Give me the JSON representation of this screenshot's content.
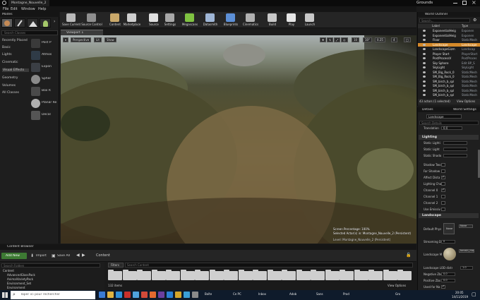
{
  "window": {
    "title": "Montagne_Nouvelle_2",
    "project": "Grounds",
    "controls": [
      "minimize-icon",
      "maximize-icon",
      "close-icon"
    ]
  },
  "menu": [
    "File",
    "Edit",
    "Window",
    "Help"
  ],
  "modes": {
    "tab_title": "Modes",
    "search_placeholder": "Search Classes",
    "categories": [
      "Recently Placed",
      "Basic",
      "Lights",
      "Cinematic",
      "Visual Effects",
      "Geometry",
      "Volumes",
      "All Classes"
    ],
    "selected_category": "Visual Effects",
    "actors": [
      "Post P",
      "Atmos",
      "Expon",
      "Spher",
      "Box R",
      "Planar Re",
      "Decal"
    ]
  },
  "toolbar": {
    "buttons": [
      {
        "label": "Save Current",
        "icon": "save-icon",
        "color": "#b9b9b9"
      },
      {
        "label": "Source Control",
        "icon": "source-control-icon",
        "color": "#8f8f8f"
      },
      {
        "label": "Content",
        "icon": "content-icon",
        "color": "#c9a86a"
      },
      {
        "label": "Marketplace",
        "icon": "marketplace-icon",
        "color": "#cfcfcf"
      },
      {
        "label": "Source",
        "icon": "source-icon",
        "color": "#e0e0e0"
      },
      {
        "label": "Settings",
        "icon": "gear-icon",
        "color": "#a8a8a8"
      },
      {
        "label": "Megascans",
        "icon": "megascans-icon",
        "color": "#7fc241"
      },
      {
        "label": "Datasmith",
        "icon": "datasmith-icon",
        "color": "#9fb6d6"
      },
      {
        "label": "Blueprints",
        "icon": "blueprints-icon",
        "color": "#5c8fd6"
      },
      {
        "label": "Cinematics",
        "icon": "cinematics-icon",
        "color": "#b0b0b0"
      },
      {
        "label": "Build",
        "icon": "build-icon",
        "color": "#c8c8c8"
      },
      {
        "label": "Play",
        "icon": "play-icon",
        "color": "#e6e6e6"
      },
      {
        "label": "Launch",
        "icon": "launch-icon",
        "color": "#c8c8c8"
      }
    ]
  },
  "viewport": {
    "tab_label": "Viewport 1",
    "perspective_label": "Perspective",
    "lit_label": "Lit",
    "show_label": "Show",
    "grid_values": [
      "10",
      "10°",
      "0.25"
    ],
    "camera_speed": "4",
    "stats": {
      "screen_percentage": "Screen Percentage:  100%",
      "selected_actor": "Selected Actor(s) in:  Montagne_Nouvelle_2 (Persistent)",
      "level": "Level:  Montagne_Nouvelle_2 (Persistent)"
    }
  },
  "outliner": {
    "title": "World Outliner",
    "search_placeholder": "Search...",
    "headers": [
      "Label",
      "Type"
    ],
    "rows": [
      {
        "name": "ExponentialHeig",
        "type": "Exponen"
      },
      {
        "name": "ExponentialHeig",
        "type": "Exponen"
      },
      {
        "name": "Floor",
        "type": "StaticMesh"
      },
      {
        "name": "Landscape",
        "type": "Landscape",
        "selected": true
      },
      {
        "name": "LandscapeGizm",
        "type": "Landscap"
      },
      {
        "name": "Player Start",
        "type": "PlayerStart"
      },
      {
        "name": "PostProcessV",
        "type": "PostProces"
      },
      {
        "name": "Sky Sphere",
        "type": "Edit BP_S"
      },
      {
        "name": "SkyLight",
        "type": "SkyLight"
      },
      {
        "name": "SM_Big_Rock_0",
        "type": "StaticMesh"
      },
      {
        "name": "SM_Big_Rock_0",
        "type": "StaticMesh"
      },
      {
        "name": "SM_birch_b_spl",
        "type": "StaticMesh"
      },
      {
        "name": "SM_birch_b_spl",
        "type": "StaticMesh"
      },
      {
        "name": "SM_birch_b_spl",
        "type": "StaticMesh"
      },
      {
        "name": "SM_birch_b_spl",
        "type": "StaticMesh"
      }
    ],
    "footer": "43 actors (1 selected)",
    "view_options": "View Options"
  },
  "details": {
    "tabs": [
      "Details",
      "World Settings"
    ],
    "actor_name": "Landscape",
    "search_placeholder": "Search Details",
    "transform_label": "Translation",
    "transform_value": "0.0",
    "lighting": {
      "header": "Lighting",
      "props": [
        {
          "name": "Static Lighti",
          "value": ""
        },
        {
          "name": "Static Light",
          "value": ""
        },
        {
          "name": "Static Shado",
          "value": ""
        },
        {
          "name": "Shadow Two",
          "checked": false
        },
        {
          "name": "Far Shadow",
          "checked": false
        },
        {
          "name": "Affect Dista",
          "checked": true
        },
        {
          "name": "Lighting Cha",
          "checked": false
        },
        {
          "name": "Channel 0",
          "checked": true
        },
        {
          "name": "Channel 1",
          "checked": false
        },
        {
          "name": "Channel 2",
          "checked": false
        },
        {
          "name": "Use Emissiv",
          "checked": false
        }
      ]
    },
    "landscape": {
      "header": "Landscape",
      "default_phys": "Default Phys",
      "default_phys_value": "None",
      "streaming_label": "Streaming D",
      "streaming_value": "0",
      "material_label": "Landscape M",
      "material_name": "terrain_ma",
      "lod_label": "Landscape LOD distr",
      "lod_value": "1.0",
      "negative_label": "Negative Zbo",
      "negative_value": "0.0",
      "positive_label": "Positive Zbo",
      "positive_value": "0.0",
      "used_for_label": "Used for Na"
    }
  },
  "content_browser": {
    "tab": "Content Browser",
    "add_new": "Add New",
    "import": "Import",
    "save_all": "Save All",
    "path": "Content",
    "folder_search": "Search Folders",
    "filters": "Filters",
    "asset_search": "Search Content",
    "tree": [
      "Content",
      "AdvancedGlassPack",
      "AnimalVarietyPack",
      "Environment_Set",
      "Environment"
    ],
    "item_count": "132 items",
    "view_options": "View Options",
    "folder_count": 21
  },
  "taskbar": {
    "search_placeholder": "Taper ici pour rechercher",
    "items": [
      "Boîte",
      "Ce PC",
      "Inbox",
      "Adob",
      "Sans",
      "Prod",
      "Gro"
    ],
    "time": "20:05",
    "date": "14/11/2019"
  }
}
